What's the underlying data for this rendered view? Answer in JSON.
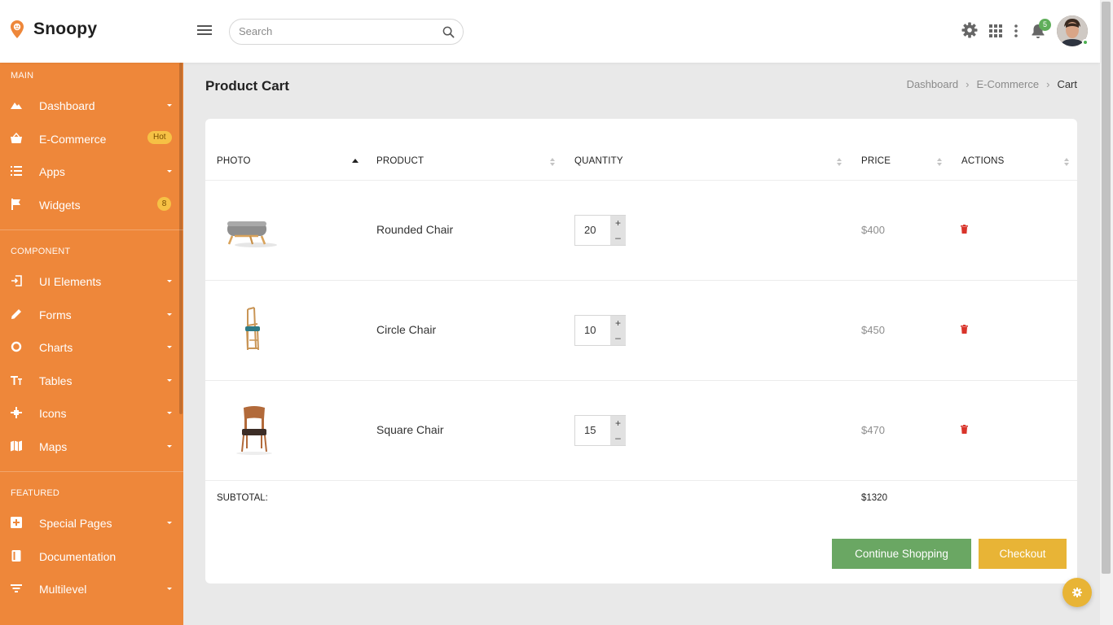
{
  "app": {
    "name": "Snoopy"
  },
  "header": {
    "search_placeholder": "Search",
    "notification_count": "5"
  },
  "sidebar": {
    "sections": [
      {
        "title": "MAIN"
      },
      {
        "title": "COMPONENT"
      },
      {
        "title": "FEATURED"
      }
    ],
    "items": [
      {
        "label": "Dashboard",
        "icon": "mountain-icon"
      },
      {
        "label": "E-Commerce",
        "icon": "basket-icon",
        "badge": "Hot"
      },
      {
        "label": "Apps",
        "icon": "list-icon"
      },
      {
        "label": "Widgets",
        "icon": "flag-icon",
        "badge": "8"
      },
      {
        "label": "UI Elements",
        "icon": "login-icon"
      },
      {
        "label": "Forms",
        "icon": "pencil-icon"
      },
      {
        "label": "Charts",
        "icon": "donut-icon"
      },
      {
        "label": "Tables",
        "icon": "text-height-icon"
      },
      {
        "label": "Icons",
        "icon": "sparkle-icon"
      },
      {
        "label": "Maps",
        "icon": "map-icon"
      },
      {
        "label": "Special Pages",
        "icon": "grid-plus-icon"
      },
      {
        "label": "Documentation",
        "icon": "book-icon"
      },
      {
        "label": "Multilevel",
        "icon": "filter-icon"
      }
    ]
  },
  "page": {
    "title": "Product Cart",
    "breadcrumb": [
      "Dashboard",
      "E-Commerce",
      "Cart"
    ]
  },
  "table": {
    "columns": [
      "PHOTO",
      "PRODUCT",
      "QUANTITY",
      "PRICE",
      "ACTIONS"
    ],
    "rows": [
      {
        "product": "Rounded Chair",
        "quantity": "20",
        "price": "$400"
      },
      {
        "product": "Circle Chair",
        "quantity": "10",
        "price": "$450"
      },
      {
        "product": "Square Chair",
        "quantity": "15",
        "price": "$470"
      }
    ],
    "subtotal_label": "SUBTOTAL:",
    "subtotal_value": "$1320"
  },
  "actions": {
    "continue_label": "Continue Shopping",
    "checkout_label": "Checkout"
  },
  "colors": {
    "sidebar": "#ee873a",
    "continue_button": "#6aa763",
    "checkout_button": "#e8b436",
    "delete_icon": "#d9342b"
  }
}
